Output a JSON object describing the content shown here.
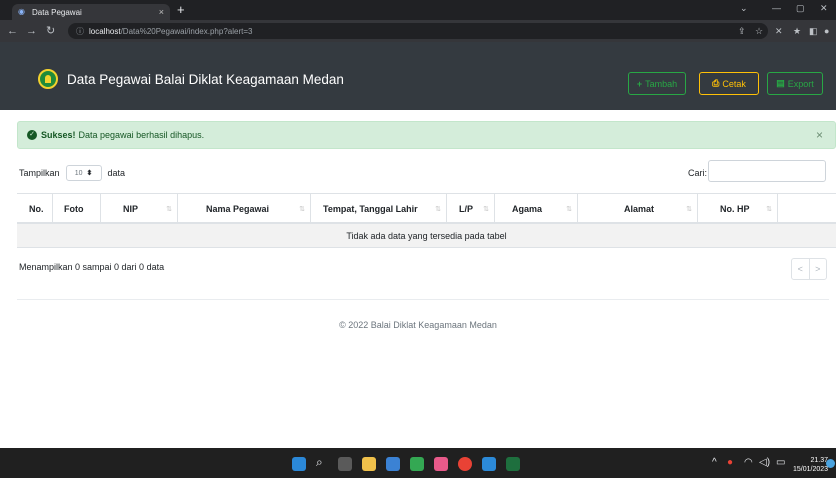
{
  "browser": {
    "tab_title": "Data Pegawai",
    "tab_close": "×",
    "new_tab": "+",
    "url_host": "localhost",
    "url_path": "/Data%20Pegawai/index.php?alert=3"
  },
  "navbar": {
    "brand": "Data Pegawai Balai Diklat Keagamaan Medan",
    "tambah_label": "Tambah",
    "cetak_label": "Cetak",
    "export_label": "Export"
  },
  "alert": {
    "strong": "Sukses!",
    "message": "Data pegawai berhasil dihapus.",
    "close": "×"
  },
  "controls": {
    "show_prefix": "Tampilkan",
    "show_value": "10",
    "show_suffix": "data",
    "search_label": "Cari:",
    "search_value": ""
  },
  "table": {
    "columns": [
      "No.",
      "Foto",
      "NIP",
      "Nama Pegawai",
      "Tempat, Tanggal Lahir",
      "L/P",
      "Agama",
      "Alamat",
      "No. HP"
    ],
    "empty_message": "Tidak ada data yang tersedia pada tabel"
  },
  "info": "Menampilkan 0 sampai 0 dari 0 data",
  "pager": {
    "prev": "<",
    "next": ">"
  },
  "footer": "© 2022 Balai Diklat Keagamaan Medan",
  "taskbar": {
    "time": "21.37",
    "date": "15/01/2023"
  },
  "colors": {
    "navbar": "#343a40",
    "alert_bg": "#d4edda",
    "success": "#28a745",
    "warning": "#ffc107"
  }
}
